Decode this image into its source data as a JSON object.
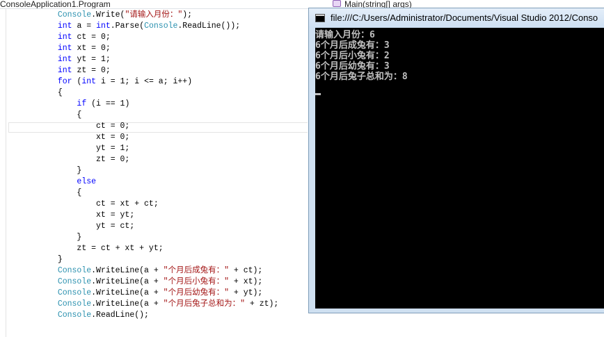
{
  "editor": {
    "nav_class": "ConsoleApplication1.Program",
    "nav_member": "Main(string[] args)",
    "code_lines": [
      [
        {
          "t": "            "
        },
        {
          "t": "Console",
          "c": "ty"
        },
        {
          "t": ".Write("
        },
        {
          "t": "\"请输入月份：\"",
          "c": "str"
        },
        {
          "t": ");"
        }
      ],
      [
        {
          "t": "            "
        },
        {
          "t": "int",
          "c": "kw"
        },
        {
          "t": " a = "
        },
        {
          "t": "int",
          "c": "kw"
        },
        {
          "t": ".Parse("
        },
        {
          "t": "Console",
          "c": "ty"
        },
        {
          "t": ".ReadLine());"
        }
      ],
      [
        {
          "t": "            "
        },
        {
          "t": "int",
          "c": "kw"
        },
        {
          "t": " ct = 0;"
        }
      ],
      [
        {
          "t": "            "
        },
        {
          "t": "int",
          "c": "kw"
        },
        {
          "t": " xt = 0;"
        }
      ],
      [
        {
          "t": "            "
        },
        {
          "t": "int",
          "c": "kw"
        },
        {
          "t": " yt = 1;"
        }
      ],
      [
        {
          "t": "            "
        },
        {
          "t": "int",
          "c": "kw"
        },
        {
          "t": " zt = 0;"
        }
      ],
      [
        {
          "t": "            "
        },
        {
          "t": "for",
          "c": "kw"
        },
        {
          "t": " ("
        },
        {
          "t": "int",
          "c": "kw"
        },
        {
          "t": " i = 1; i <= a; i++)"
        }
      ],
      [
        {
          "t": "            {"
        }
      ],
      [
        {
          "t": "                "
        },
        {
          "t": "if",
          "c": "kw"
        },
        {
          "t": " (i == 1)"
        }
      ],
      [
        {
          "t": "                {"
        }
      ],
      [
        {
          "t": "                    ct = 0;"
        }
      ],
      [
        {
          "t": "                    xt = 0;"
        }
      ],
      [
        {
          "t": "                    yt = 1;"
        }
      ],
      [
        {
          "t": "                    zt = 0;"
        }
      ],
      [
        {
          "t": "                }"
        }
      ],
      [
        {
          "t": "                "
        },
        {
          "t": "else",
          "c": "kw"
        }
      ],
      [
        {
          "t": "                {"
        }
      ],
      [
        {
          "t": "                    ct = xt + ct;"
        }
      ],
      [
        {
          "t": "                    xt = yt;"
        }
      ],
      [
        {
          "t": "                    yt = ct;"
        }
      ],
      [
        {
          "t": "                }"
        }
      ],
      [
        {
          "t": "                zt = ct + xt + yt;"
        }
      ],
      [
        {
          "t": "            }"
        }
      ],
      [
        {
          "t": "            "
        },
        {
          "t": "Console",
          "c": "ty"
        },
        {
          "t": ".WriteLine(a + "
        },
        {
          "t": "\"个月后成兔有：\"",
          "c": "str"
        },
        {
          "t": " + ct);"
        }
      ],
      [
        {
          "t": "            "
        },
        {
          "t": "Console",
          "c": "ty"
        },
        {
          "t": ".WriteLine(a + "
        },
        {
          "t": "\"个月后小兔有：\"",
          "c": "str"
        },
        {
          "t": " + xt);"
        }
      ],
      [
        {
          "t": "            "
        },
        {
          "t": "Console",
          "c": "ty"
        },
        {
          "t": ".WriteLine(a + "
        },
        {
          "t": "\"个月后幼兔有：\"",
          "c": "str"
        },
        {
          "t": " + yt);"
        }
      ],
      [
        {
          "t": "            "
        },
        {
          "t": "Console",
          "c": "ty"
        },
        {
          "t": ".WriteLine(a + "
        },
        {
          "t": "\"个月后兔子总和为：\"",
          "c": "str"
        },
        {
          "t": " + zt);"
        }
      ],
      [
        {
          "t": "            "
        },
        {
          "t": "Console",
          "c": "ty"
        },
        {
          "t": ".ReadLine();"
        }
      ]
    ],
    "colors": {
      "keyword": "#0000ff",
      "type": "#2b91af",
      "string": "#a31515",
      "text": "#000000"
    }
  },
  "console": {
    "title": "file:///C:/Users/Administrator/Documents/Visual Studio 2012/Conso",
    "output_lines": [
      "请输入月份：6",
      "6个月后成兔有：3",
      "6个月后小兔有：2",
      "6个月后幼兔有：3",
      "6个月后兔子总和为：8"
    ],
    "icon": "console-app-icon"
  }
}
